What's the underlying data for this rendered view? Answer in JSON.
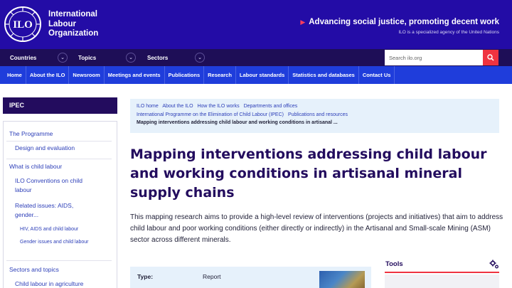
{
  "header": {
    "org_line1": "International",
    "org_line2": "Labour",
    "org_line3": "Organization",
    "logo_text": "ILO",
    "tagline": "Advancing social justice, promoting decent work",
    "agency_note": "ILO is a specialized agency of the United Nations"
  },
  "dropdowns": [
    "Countries",
    "Topics",
    "Sectors"
  ],
  "search": {
    "placeholder": "Search ilo.org"
  },
  "nav": [
    "Home",
    "About the ILO",
    "Newsroom",
    "Meetings and events",
    "Publications",
    "Research",
    "Labour standards",
    "Statistics and databases",
    "Contact Us"
  ],
  "sidebar": {
    "heading": "IPEC",
    "items": [
      "The Programme",
      "Design and evaluation",
      "What is child labour",
      "ILO Conventions on child labour",
      "Related issues: AIDS, gender...",
      "HIV, AIDS and child labour",
      "Gender issues and child labour",
      "Sectors and topics",
      "Child labour in agriculture"
    ]
  },
  "breadcrumb": {
    "row1": [
      "ILO home",
      "About the ILO",
      "How the ILO works",
      "Departments and offices"
    ],
    "row2": [
      "International Programme on the Elimination of Child Labour (IPEC)",
      "Publications and resources"
    ],
    "current": "Mapping interventions addressing child labour and working conditions in artisanal ..."
  },
  "article": {
    "title": "Mapping interventions addressing child labour and working conditions in artisanal mineral supply chains",
    "lede": "This mapping research aims to provide a high-level review of interventions (projects and initiatives) that aim to address child labour and poor working conditions (either directly or indirectly) in the Artisanal and Small-scale Mining (ASM) sector across different minerals.",
    "type_label": "Type:",
    "type_value": "Report"
  },
  "tools": {
    "title": "Tools",
    "icon": "gear-icon"
  },
  "colors": {
    "banner": "#230ca6",
    "dropbar": "#1e0e57",
    "nav": "#1f3ddb",
    "accent_red": "#ef3340",
    "link": "#2c3eb8",
    "breadcrumb_bg": "#e6f1fb"
  }
}
